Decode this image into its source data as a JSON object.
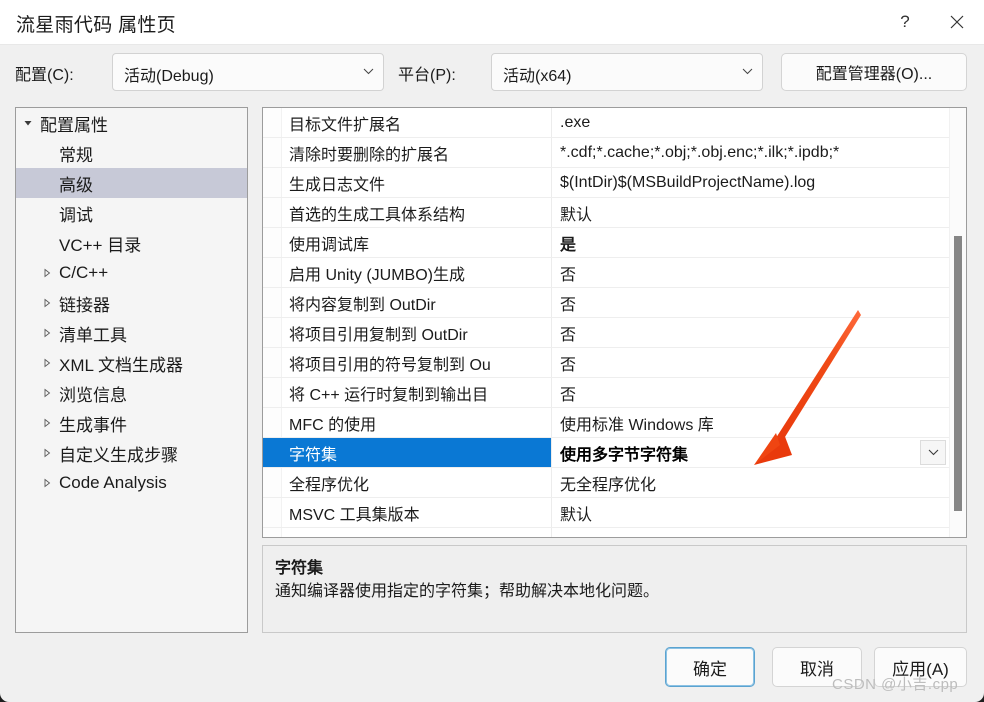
{
  "window": {
    "title": "流星雨代码 属性页",
    "help_icon": "?",
    "help_icon_name": "help-icon",
    "close_icon_name": "close-icon"
  },
  "config_bar": {
    "config_label": "配置(C):",
    "config_value": "活动(Debug)",
    "platform_label": "平台(P):",
    "platform_value": "活动(x64)",
    "config_manager_button": "配置管理器(O)..."
  },
  "tree": {
    "items": [
      {
        "label": "配置属性",
        "depth": 0,
        "arrow": "expanded",
        "selected": false
      },
      {
        "label": "常规",
        "depth": 1,
        "arrow": "none",
        "selected": false
      },
      {
        "label": "高级",
        "depth": 1,
        "arrow": "none",
        "selected": true
      },
      {
        "label": "调试",
        "depth": 1,
        "arrow": "none",
        "selected": false
      },
      {
        "label": "VC++ 目录",
        "depth": 1,
        "arrow": "none",
        "selected": false
      },
      {
        "label": "C/C++",
        "depth": 1,
        "arrow": "collapsed",
        "selected": false
      },
      {
        "label": "链接器",
        "depth": 1,
        "arrow": "collapsed",
        "selected": false
      },
      {
        "label": "清单工具",
        "depth": 1,
        "arrow": "collapsed",
        "selected": false
      },
      {
        "label": "XML 文档生成器",
        "depth": 1,
        "arrow": "collapsed",
        "selected": false
      },
      {
        "label": "浏览信息",
        "depth": 1,
        "arrow": "collapsed",
        "selected": false
      },
      {
        "label": "生成事件",
        "depth": 1,
        "arrow": "collapsed",
        "selected": false
      },
      {
        "label": "自定义生成步骤",
        "depth": 1,
        "arrow": "collapsed",
        "selected": false
      },
      {
        "label": "Code Analysis",
        "depth": 1,
        "arrow": "collapsed",
        "selected": false
      }
    ]
  },
  "grid": {
    "rows": [
      {
        "name": "目标文件扩展名",
        "value": ".exe",
        "selected": false,
        "bold": false
      },
      {
        "name": "清除时要删除的扩展名",
        "value": "*.cdf;*.cache;*.obj;*.obj.enc;*.ilk;*.ipdb;*",
        "selected": false,
        "bold": false
      },
      {
        "name": "生成日志文件",
        "value": "$(IntDir)$(MSBuildProjectName).log",
        "selected": false,
        "bold": false
      },
      {
        "name": "首选的生成工具体系结构",
        "value": "默认",
        "selected": false,
        "bold": false
      },
      {
        "name": "使用调试库",
        "value": "是",
        "selected": false,
        "bold": true
      },
      {
        "name": "启用 Unity (JUMBO)生成",
        "value": "否",
        "selected": false,
        "bold": false
      },
      {
        "name": "将内容复制到 OutDir",
        "value": "否",
        "selected": false,
        "bold": false
      },
      {
        "name": "将项目引用复制到 OutDir",
        "value": "否",
        "selected": false,
        "bold": false
      },
      {
        "name": "将项目引用的符号复制到 Ou",
        "value": "否",
        "selected": false,
        "bold": false
      },
      {
        "name": "将 C++ 运行时复制到输出目",
        "value": "否",
        "selected": false,
        "bold": false
      },
      {
        "name": "MFC 的使用",
        "value": "使用标准 Windows 库",
        "selected": false,
        "bold": false
      },
      {
        "name": "字符集",
        "value": "使用多字节字符集",
        "selected": true,
        "bold": true
      },
      {
        "name": "全程序优化",
        "value": "无全程序优化",
        "selected": false,
        "bold": false
      },
      {
        "name": "MSVC 工具集版本",
        "value": "默认",
        "selected": false,
        "bold": false
      }
    ],
    "dropdown_icon": "chevron-down-icon",
    "scrollbar_present": true
  },
  "description": {
    "title": "字符集",
    "body": "通知编译器使用指定的字符集；帮助解决本地化问题。"
  },
  "footer": {
    "ok": "确定",
    "cancel": "取消",
    "apply": "应用(A)"
  },
  "annotation": {
    "arrow_color": "#ef3b11",
    "arrow_name": "red-annotation-arrow"
  },
  "watermark": {
    "text": "CSDN @小吉.cpp",
    "color": "#bdbdbd"
  },
  "colors": {
    "selection_blue": "#0a78d4",
    "tree_selection": "#c7c9d7",
    "dialog_bg": "#f0f0f0",
    "titlebar_bg": "#ffffff"
  }
}
